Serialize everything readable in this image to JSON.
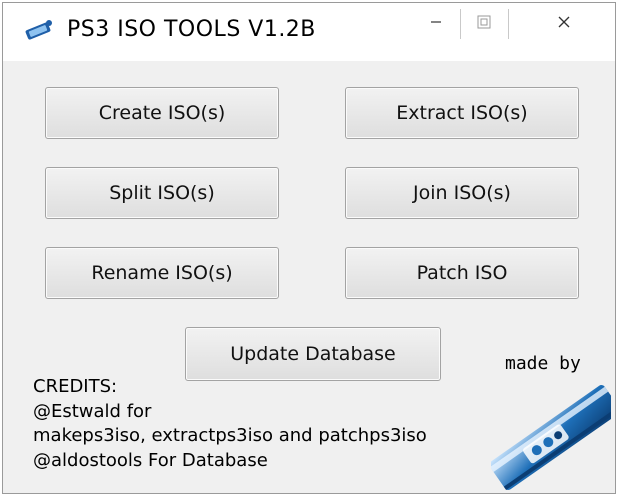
{
  "window": {
    "title": "PS3 ISO TOOLS V1.2B",
    "controls": {
      "minimize": "minimize",
      "maximize": "maximize",
      "close": "close"
    }
  },
  "buttons": {
    "create": "Create ISO(s)",
    "extract": "Extract ISO(s)",
    "split": "Split ISO(s)",
    "join": "Join ISO(s)",
    "rename": "Rename ISO(s)",
    "patch": "Patch ISO",
    "update_db": "Update Database"
  },
  "credits": {
    "lines": [
      "CREDITS:",
      "@Estwald for",
      "makeps3iso, extractps3iso and patchps3iso",
      "@aldostools For Database"
    ]
  },
  "made_by": "made by",
  "colors": {
    "window_bg": "#f0f0f0",
    "button_border": "#a3a3a3",
    "logo_blue": "#1e6fb8"
  }
}
